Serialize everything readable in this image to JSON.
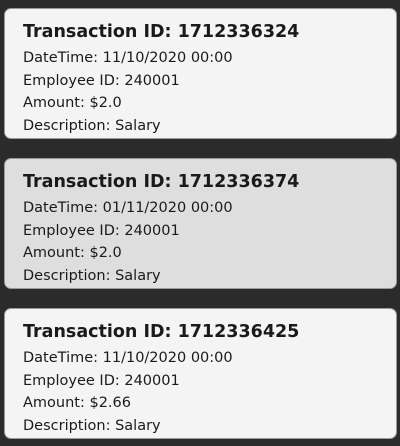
{
  "transactions": [
    {
      "title": "Transaction ID: 1712336324",
      "datetime": "DateTime: 11/10/2020 00:00",
      "employee": "Employee ID: 240001",
      "amount": "Amount: $2.0",
      "description": "Description: Salary",
      "selected": false
    },
    {
      "title": "Transaction ID: 1712336374",
      "datetime": "DateTime: 01/11/2020 00:00",
      "employee": "Employee ID: 240001",
      "amount": "Amount: $2.0",
      "description": "Description: Salary",
      "selected": true
    },
    {
      "title": "Transaction ID: 1712336425",
      "datetime": "DateTime: 11/10/2020 00:00",
      "employee": "Employee ID: 240001",
      "amount": "Amount: $2.66",
      "description": "Description: Salary",
      "selected": false
    }
  ],
  "colors": {
    "background": "#2b2b2b",
    "card": "#f4f4f4",
    "card_selected": "#dedede",
    "border": "#9a9a9a"
  }
}
